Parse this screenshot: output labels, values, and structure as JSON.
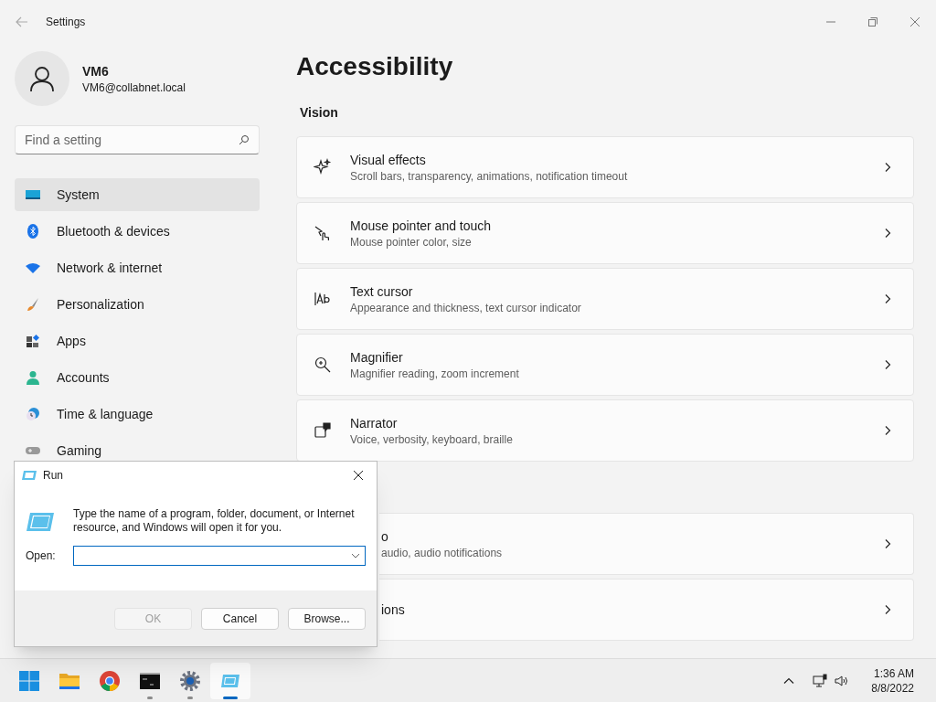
{
  "window": {
    "title": "Settings"
  },
  "profile": {
    "name": "VM6",
    "email": "VM6@collabnet.local"
  },
  "search": {
    "placeholder": "Find a setting"
  },
  "nav": [
    {
      "label": "System",
      "selected": true
    },
    {
      "label": "Bluetooth & devices",
      "selected": false
    },
    {
      "label": "Network & internet",
      "selected": false
    },
    {
      "label": "Personalization",
      "selected": false
    },
    {
      "label": "Apps",
      "selected": false
    },
    {
      "label": "Accounts",
      "selected": false
    },
    {
      "label": "Time & language",
      "selected": false
    },
    {
      "label": "Gaming",
      "selected": false
    }
  ],
  "page": {
    "title": "Accessibility",
    "section": "Vision",
    "cards": [
      {
        "kind": "full",
        "title": "Visual effects",
        "subtitle": "Scroll bars, transparency, animations, notification timeout"
      },
      {
        "kind": "full",
        "title": "Mouse pointer and touch",
        "subtitle": "Mouse pointer color, size"
      },
      {
        "kind": "full",
        "title": "Text cursor",
        "subtitle": "Appearance and thickness, text cursor indicator"
      },
      {
        "kind": "full",
        "title": "Magnifier",
        "subtitle": "Magnifier reading, zoom increment"
      },
      {
        "kind": "full",
        "title": "Narrator",
        "subtitle": "Voice, verbosity, keyboard, braille"
      }
    ],
    "covered_cards": [
      {
        "kind": "covered",
        "title": "o",
        "subtitle": "audio, audio notifications"
      },
      {
        "kind": "covered",
        "title": "ions"
      }
    ]
  },
  "run_dialog": {
    "title": "Run",
    "message": "Type the name of a program, folder, document, or Internet resource, and Windows will open it for you.",
    "open_label": "Open:",
    "buttons": [
      {
        "label": "OK",
        "disabled": true
      },
      {
        "label": "Cancel",
        "disabled": false
      },
      {
        "label": "Browse...",
        "disabled": false
      }
    ]
  },
  "taskbar": {
    "apps": [
      {
        "running": false,
        "selected": false
      },
      {
        "running": false,
        "selected": false
      },
      {
        "running": false,
        "selected": false
      },
      {
        "running": true,
        "selected": false
      },
      {
        "running": true,
        "selected": false
      },
      {
        "running": true,
        "selected": true
      }
    ],
    "time": "1:36 AM",
    "date": "8/8/2022"
  }
}
